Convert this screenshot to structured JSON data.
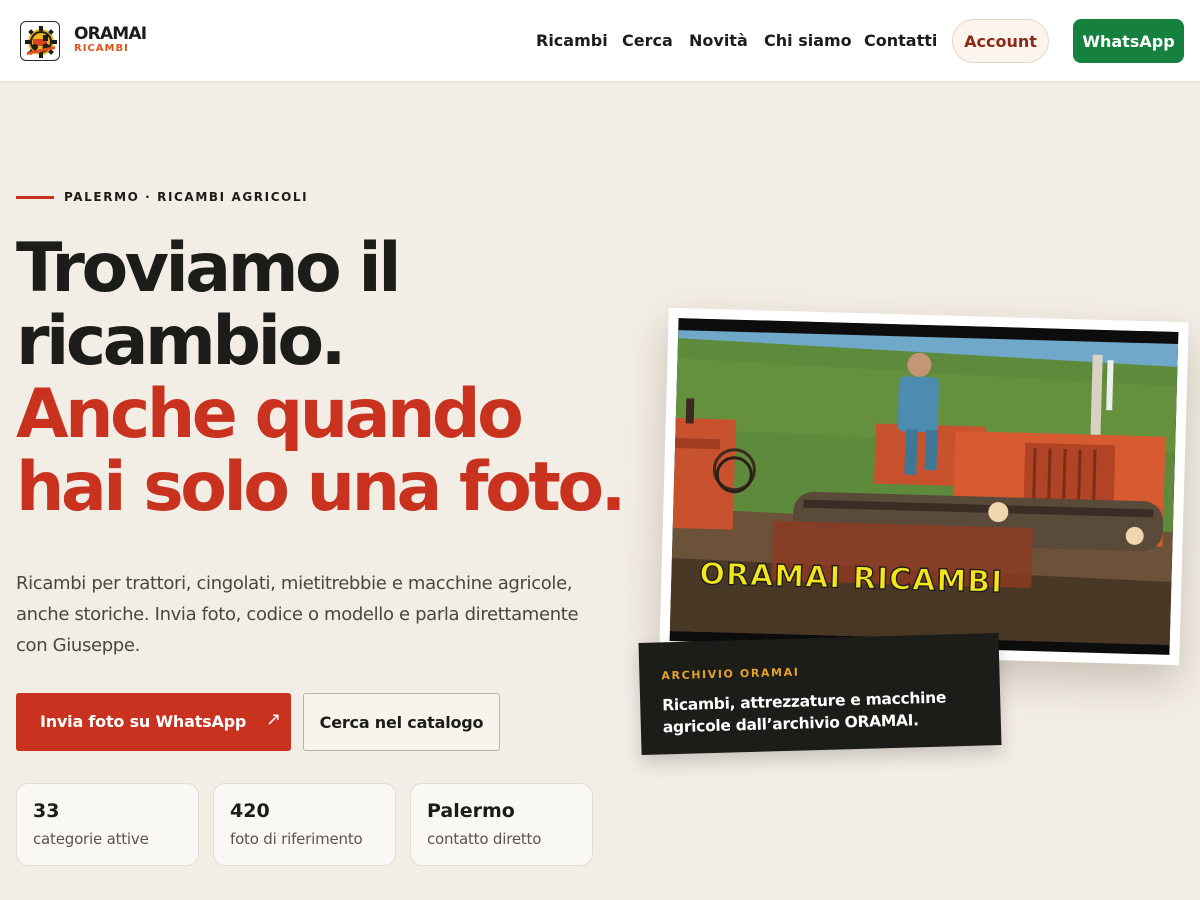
{
  "brand": {
    "name": "ORAMAI",
    "sub": "RICAMBI",
    "logo_icon": "gear-tractor-icon"
  },
  "nav": {
    "items": [
      {
        "label": "Ricambi"
      },
      {
        "label": "Cerca"
      },
      {
        "label": "Novità"
      },
      {
        "label": "Chi siamo"
      },
      {
        "label": "Contatti"
      }
    ],
    "account_label": "Account",
    "whatsapp_label": "WhatsApp"
  },
  "hero": {
    "eyebrow": "PALERMO · RICAMBI AGRICOLI",
    "headline_line1": "Troviamo il",
    "headline_line2": "ricambio.",
    "headline_line3": "Anche quando",
    "headline_line4": "hai solo una foto.",
    "lead": "Ricambi per trattori, cingolati, mietitrebbie e macchine agricole, anche storiche. Invia foto, codice o modello e parla direttamente con Giuseppe.",
    "primary_cta": "Invia foto su WhatsApp",
    "primary_cta_icon": "arrow-up-right-icon",
    "secondary_cta": "Cerca nel catalogo"
  },
  "stats": [
    {
      "value": "33",
      "label": "categorie attive"
    },
    {
      "value": "420",
      "label": "foto di riferimento"
    },
    {
      "value": "Palermo",
      "label": "contatto diretto"
    }
  ],
  "photo": {
    "caption": "ORAMAI RICAMBI"
  },
  "archive": {
    "tag": "ARCHIVIO ORAMAI",
    "text": "Ricambi, attrezzature e macchine agricole dall’archivio ORAMAI."
  },
  "colors": {
    "accent_red": "#c8321f",
    "whatsapp_green": "#16803e",
    "background": "#f2ede5",
    "caption_yellow": "#f5e61a"
  }
}
